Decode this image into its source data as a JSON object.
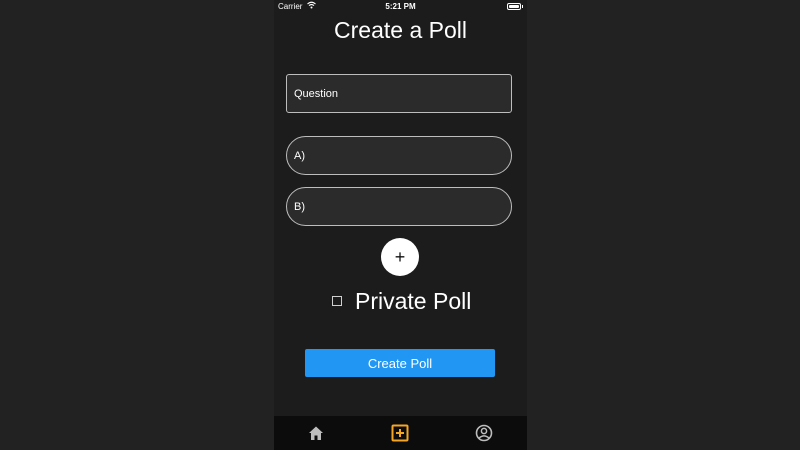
{
  "status_bar": {
    "carrier": "Carrier",
    "time": "5:21 PM"
  },
  "page": {
    "title": "Create a Poll"
  },
  "form": {
    "question_placeholder": "Question",
    "option_a_placeholder": "A)",
    "option_b_placeholder": "B)",
    "add_option_label": "+",
    "private_label": "Private Poll",
    "private_checked": false,
    "submit_label": "Create Poll"
  },
  "tab_bar": {
    "items": [
      {
        "icon": "home-icon",
        "active": false
      },
      {
        "icon": "add-square-icon",
        "active": true
      },
      {
        "icon": "account-circle-icon",
        "active": false
      }
    ],
    "active_color": "#f5a623",
    "inactive_color": "#bdbdbd"
  },
  "colors": {
    "accent": "#2196f3",
    "background": "#1c1c1c"
  }
}
